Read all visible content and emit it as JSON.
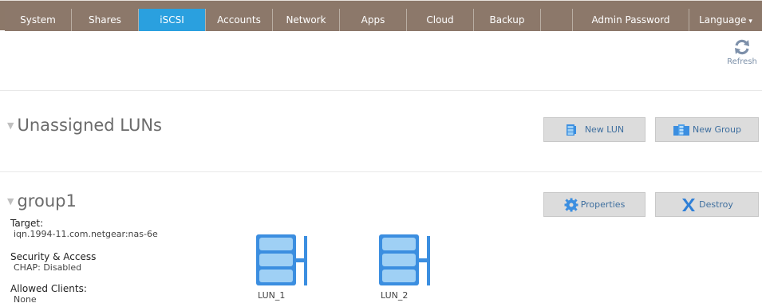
{
  "nav": {
    "tabs": [
      {
        "label": "System"
      },
      {
        "label": "Shares"
      },
      {
        "label": "iSCSI"
      },
      {
        "label": "Accounts"
      },
      {
        "label": "Network"
      },
      {
        "label": "Apps"
      },
      {
        "label": "Cloud"
      },
      {
        "label": "Backup"
      },
      {
        "label": ""
      },
      {
        "label": "Admin Password"
      },
      {
        "label": "Language"
      }
    ],
    "active": "iSCSI",
    "language_arrow": "▾"
  },
  "refresh": {
    "label": "Refresh"
  },
  "unassigned": {
    "title": "Unassigned LUNs",
    "new_lun_label": "New LUN",
    "new_group_label": "New Group"
  },
  "group": {
    "title": "group1",
    "properties_label": "Properties",
    "destroy_label": "Destroy",
    "target_key": "Target:",
    "target_value": "iqn.1994-11.com.netgear:nas-6e",
    "security_key": "Security & Access",
    "security_value": "CHAP: Disabled",
    "clients_key": "Allowed Clients:",
    "clients_value": "None",
    "luns": [
      {
        "name": "LUN_1"
      },
      {
        "name": "LUN_2"
      }
    ]
  },
  "colors": {
    "nav_bg": "#8c786a",
    "nav_active": "#2aa0df",
    "button_bg": "#dcdcdc",
    "button_text": "#3f6f9f",
    "lun_blue": "#3b8ee0"
  },
  "icons": [
    "refresh-icon",
    "lun-icon",
    "group-icon",
    "gear-icon",
    "x-icon",
    "caret-down-icon"
  ]
}
